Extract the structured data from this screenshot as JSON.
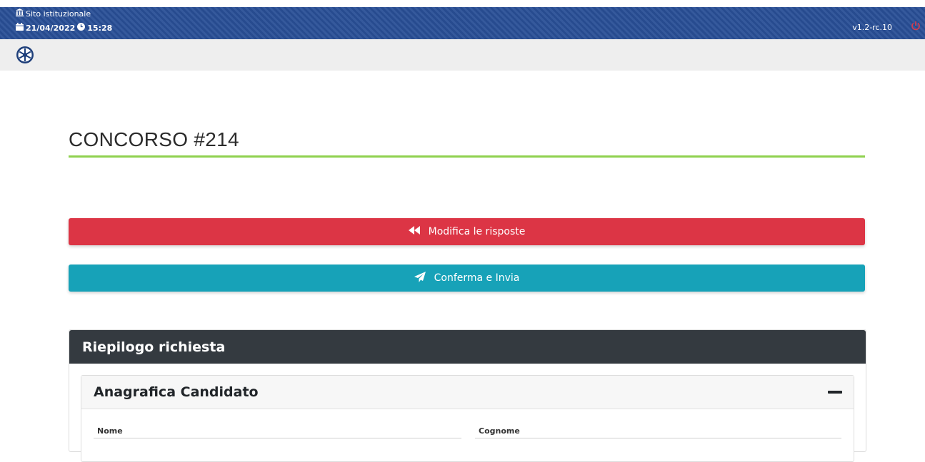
{
  "topbar": {
    "site_label": "Sito istituzionale",
    "date": "21/04/2022",
    "time": "15:28",
    "version": "v1.2-rc.10",
    "colors": {
      "stripe_dark": "#274b8f",
      "stripe_light": "#35599c",
      "power": "#d93a4a"
    }
  },
  "page": {
    "title": "CONCORSO #214",
    "accent": "#8fd14f"
  },
  "actions": {
    "modify_label": "Modifica le risposte",
    "confirm_label": "Conferma e Invia",
    "colors": {
      "modify": "#dc3545",
      "confirm": "#17a2b8"
    }
  },
  "summary": {
    "title": "Riepilogo richiesta",
    "section": {
      "title": "Anagrafica Candidato",
      "fields": [
        {
          "label": "Nome"
        },
        {
          "label": "Cognome"
        }
      ]
    }
  },
  "icons": {
    "site": "institution-icon",
    "calendar": "calendar-icon",
    "clock": "clock-icon",
    "power": "power-icon",
    "logo": "app-logo",
    "modify": "fast-backward-icon",
    "confirm": "paper-plane-icon",
    "collapse": "minus-icon"
  }
}
